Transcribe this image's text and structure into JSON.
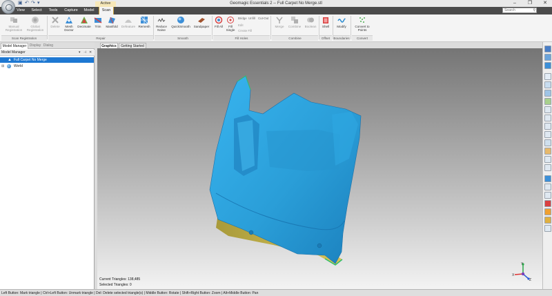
{
  "window": {
    "title": "Geomagic Essentials 2 -- Full Carpet No Merge.stl",
    "controls": [
      "–",
      "❐",
      "✕"
    ]
  },
  "quick_access": [
    "▣",
    "↶",
    "↷",
    "▾"
  ],
  "menu": {
    "context_label": "Active",
    "tabs": [
      "View",
      "Select",
      "Tools",
      "Capture",
      "Model",
      "Scan"
    ],
    "active_tab": "Scan",
    "search_placeholder": "Search"
  },
  "ribbon": {
    "groups": [
      {
        "label": "Scan Registration",
        "buttons": [
          {
            "label": "Manual Registration",
            "icon": "manual-registration-icon",
            "enabled": false
          },
          {
            "label": "Global Registration",
            "icon": "global-registration-icon",
            "enabled": false
          }
        ]
      },
      {
        "label": "Repair",
        "buttons": [
          {
            "label": "Delete",
            "icon": "delete-icon",
            "enabled": false
          },
          {
            "label": "Mesh Doctor",
            "icon": "mesh-doctor-icon",
            "enabled": true
          },
          {
            "label": "Decimate",
            "icon": "decimate-icon",
            "enabled": true
          },
          {
            "label": "Trim",
            "icon": "trim-icon",
            "enabled": true
          },
          {
            "label": "Manifold",
            "icon": "manifold-icon",
            "enabled": true
          },
          {
            "label": "Defeature",
            "icon": "defeature-icon",
            "enabled": false
          },
          {
            "label": "Remesh",
            "icon": "remesh-icon",
            "enabled": true
          }
        ]
      },
      {
        "label": "Smooth",
        "buttons": [
          {
            "label": "Reduce Noise",
            "icon": "reduce-noise-icon",
            "enabled": true
          },
          {
            "label": "QuickSmooth",
            "icon": "quicksmooth-icon",
            "enabled": true
          },
          {
            "label": "Sandpaper",
            "icon": "sandpaper-icon",
            "enabled": true
          }
        ]
      },
      {
        "label": "Fill Holes",
        "buttons": [
          {
            "label": "Fill All",
            "icon": "fill-all-icon",
            "enabled": true
          },
          {
            "label": "Fill Single",
            "icon": "fill-single-icon",
            "enabled": true
          }
        ],
        "small": [
          "Bridge",
          "Unfill",
          "Cut-Out",
          "Edit",
          "Create Fill"
        ]
      },
      {
        "label": "Combine",
        "buttons": [
          {
            "label": "Merge",
            "icon": "merge-icon",
            "enabled": false
          },
          {
            "label": "Combine",
            "icon": "combine-icon",
            "enabled": false
          },
          {
            "label": "Boolean",
            "icon": "boolean-icon",
            "enabled": false
          }
        ]
      },
      {
        "label": "Offset",
        "buttons": [
          {
            "label": "Shell",
            "icon": "shell-icon",
            "enabled": true
          }
        ]
      },
      {
        "label": "Boundaries",
        "buttons": [
          {
            "label": "Modify",
            "icon": "modify-icon",
            "enabled": true
          }
        ]
      },
      {
        "label": "Convert",
        "buttons": [
          {
            "label": "Convert to Points",
            "icon": "convert-to-points-icon",
            "enabled": true
          }
        ]
      }
    ]
  },
  "left_panel": {
    "tabs": [
      "Model Manager",
      "Display",
      "Dialog"
    ],
    "header": "Model Manager",
    "header_controls": [
      "▾",
      "⊣",
      "✕"
    ],
    "tree": [
      {
        "label": "Full Carpet No Merge",
        "selected": true
      },
      {
        "label": "World",
        "selected": false
      }
    ]
  },
  "view_tabs": [
    "Graphics",
    "Getting Started"
  ],
  "viewport": {
    "current_triangles_label": "Current Triangles:",
    "current_triangles": "138,485",
    "selected_triangles_label": "Selected Triangles:",
    "selected_triangles": "0",
    "axis_labels": [
      "Y",
      "X",
      "Z"
    ]
  },
  "colors": {
    "mesh_blue": "#2a9ed8",
    "mesh_yellow": "#c9b64a",
    "selection": "#1e78d2",
    "menubar": "#4b4b4b"
  },
  "statusbar": {
    "text": "Left Button: Mark triangle | Ctrl+Left Button: Unmark triangle | Del: Delete selected triangle(s) | Middle Button: Rotate | Shift+Right Button: Zoom | Alt+Middle Button: Pan"
  }
}
